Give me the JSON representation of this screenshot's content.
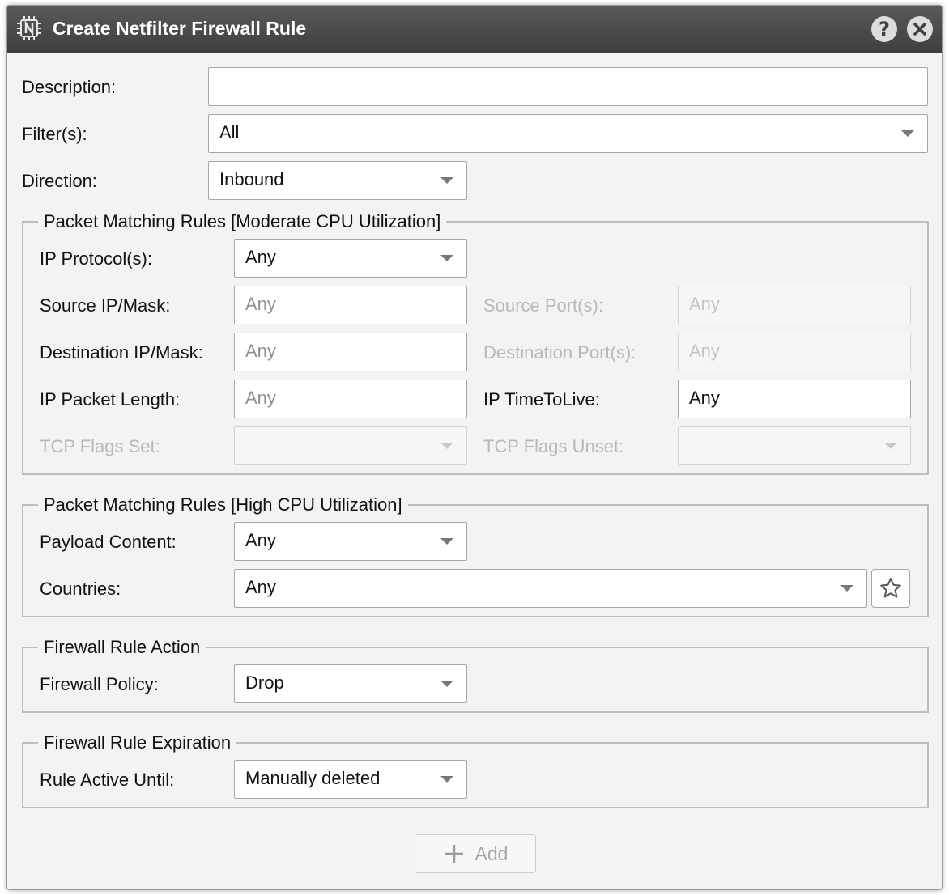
{
  "dialog": {
    "title": "Create Netfilter Firewall Rule",
    "help_label": "?"
  },
  "fields": {
    "description": {
      "label": "Description:",
      "value": ""
    },
    "filters": {
      "label": "Filter(s):",
      "value": "All"
    },
    "direction": {
      "label": "Direction:",
      "value": "Inbound"
    }
  },
  "moderate": {
    "legend": "Packet Matching Rules [Moderate CPU Utilization]",
    "ip_protocols": {
      "label": "IP Protocol(s):",
      "value": "Any"
    },
    "source_ip": {
      "label": "Source IP/Mask:",
      "placeholder": "Any"
    },
    "source_ports": {
      "label": "Source Port(s):",
      "placeholder": "Any"
    },
    "dest_ip": {
      "label": "Destination IP/Mask:",
      "placeholder": "Any"
    },
    "dest_ports": {
      "label": "Destination Port(s):",
      "placeholder": "Any"
    },
    "packet_length": {
      "label": "IP Packet Length:",
      "placeholder": "Any"
    },
    "ttl": {
      "label": "IP TimeToLive:",
      "value": "Any"
    },
    "tcp_flags_set": {
      "label": "TCP Flags Set:",
      "value": ""
    },
    "tcp_flags_unset": {
      "label": "TCP Flags Unset:",
      "value": ""
    }
  },
  "high": {
    "legend": "Packet Matching Rules [High CPU Utilization]",
    "payload": {
      "label": "Payload Content:",
      "value": "Any"
    },
    "countries": {
      "label": "Countries:",
      "value": "Any"
    }
  },
  "action": {
    "legend": "Firewall Rule Action",
    "policy": {
      "label": "Firewall Policy:",
      "value": "Drop"
    }
  },
  "expiration": {
    "legend": "Firewall Rule Expiration",
    "active_until": {
      "label": "Rule Active Until:",
      "value": "Manually deleted"
    }
  },
  "footer": {
    "add_label": "Add"
  },
  "icons": {
    "app": "chip-icon",
    "help": "help-icon",
    "close": "close-icon",
    "favorite": "star-icon",
    "add": "plus-icon"
  },
  "colors": {
    "titlebar": "#474747",
    "dialog_bg": "#f3f3f3",
    "disabled_text": "#b8b8b8"
  }
}
